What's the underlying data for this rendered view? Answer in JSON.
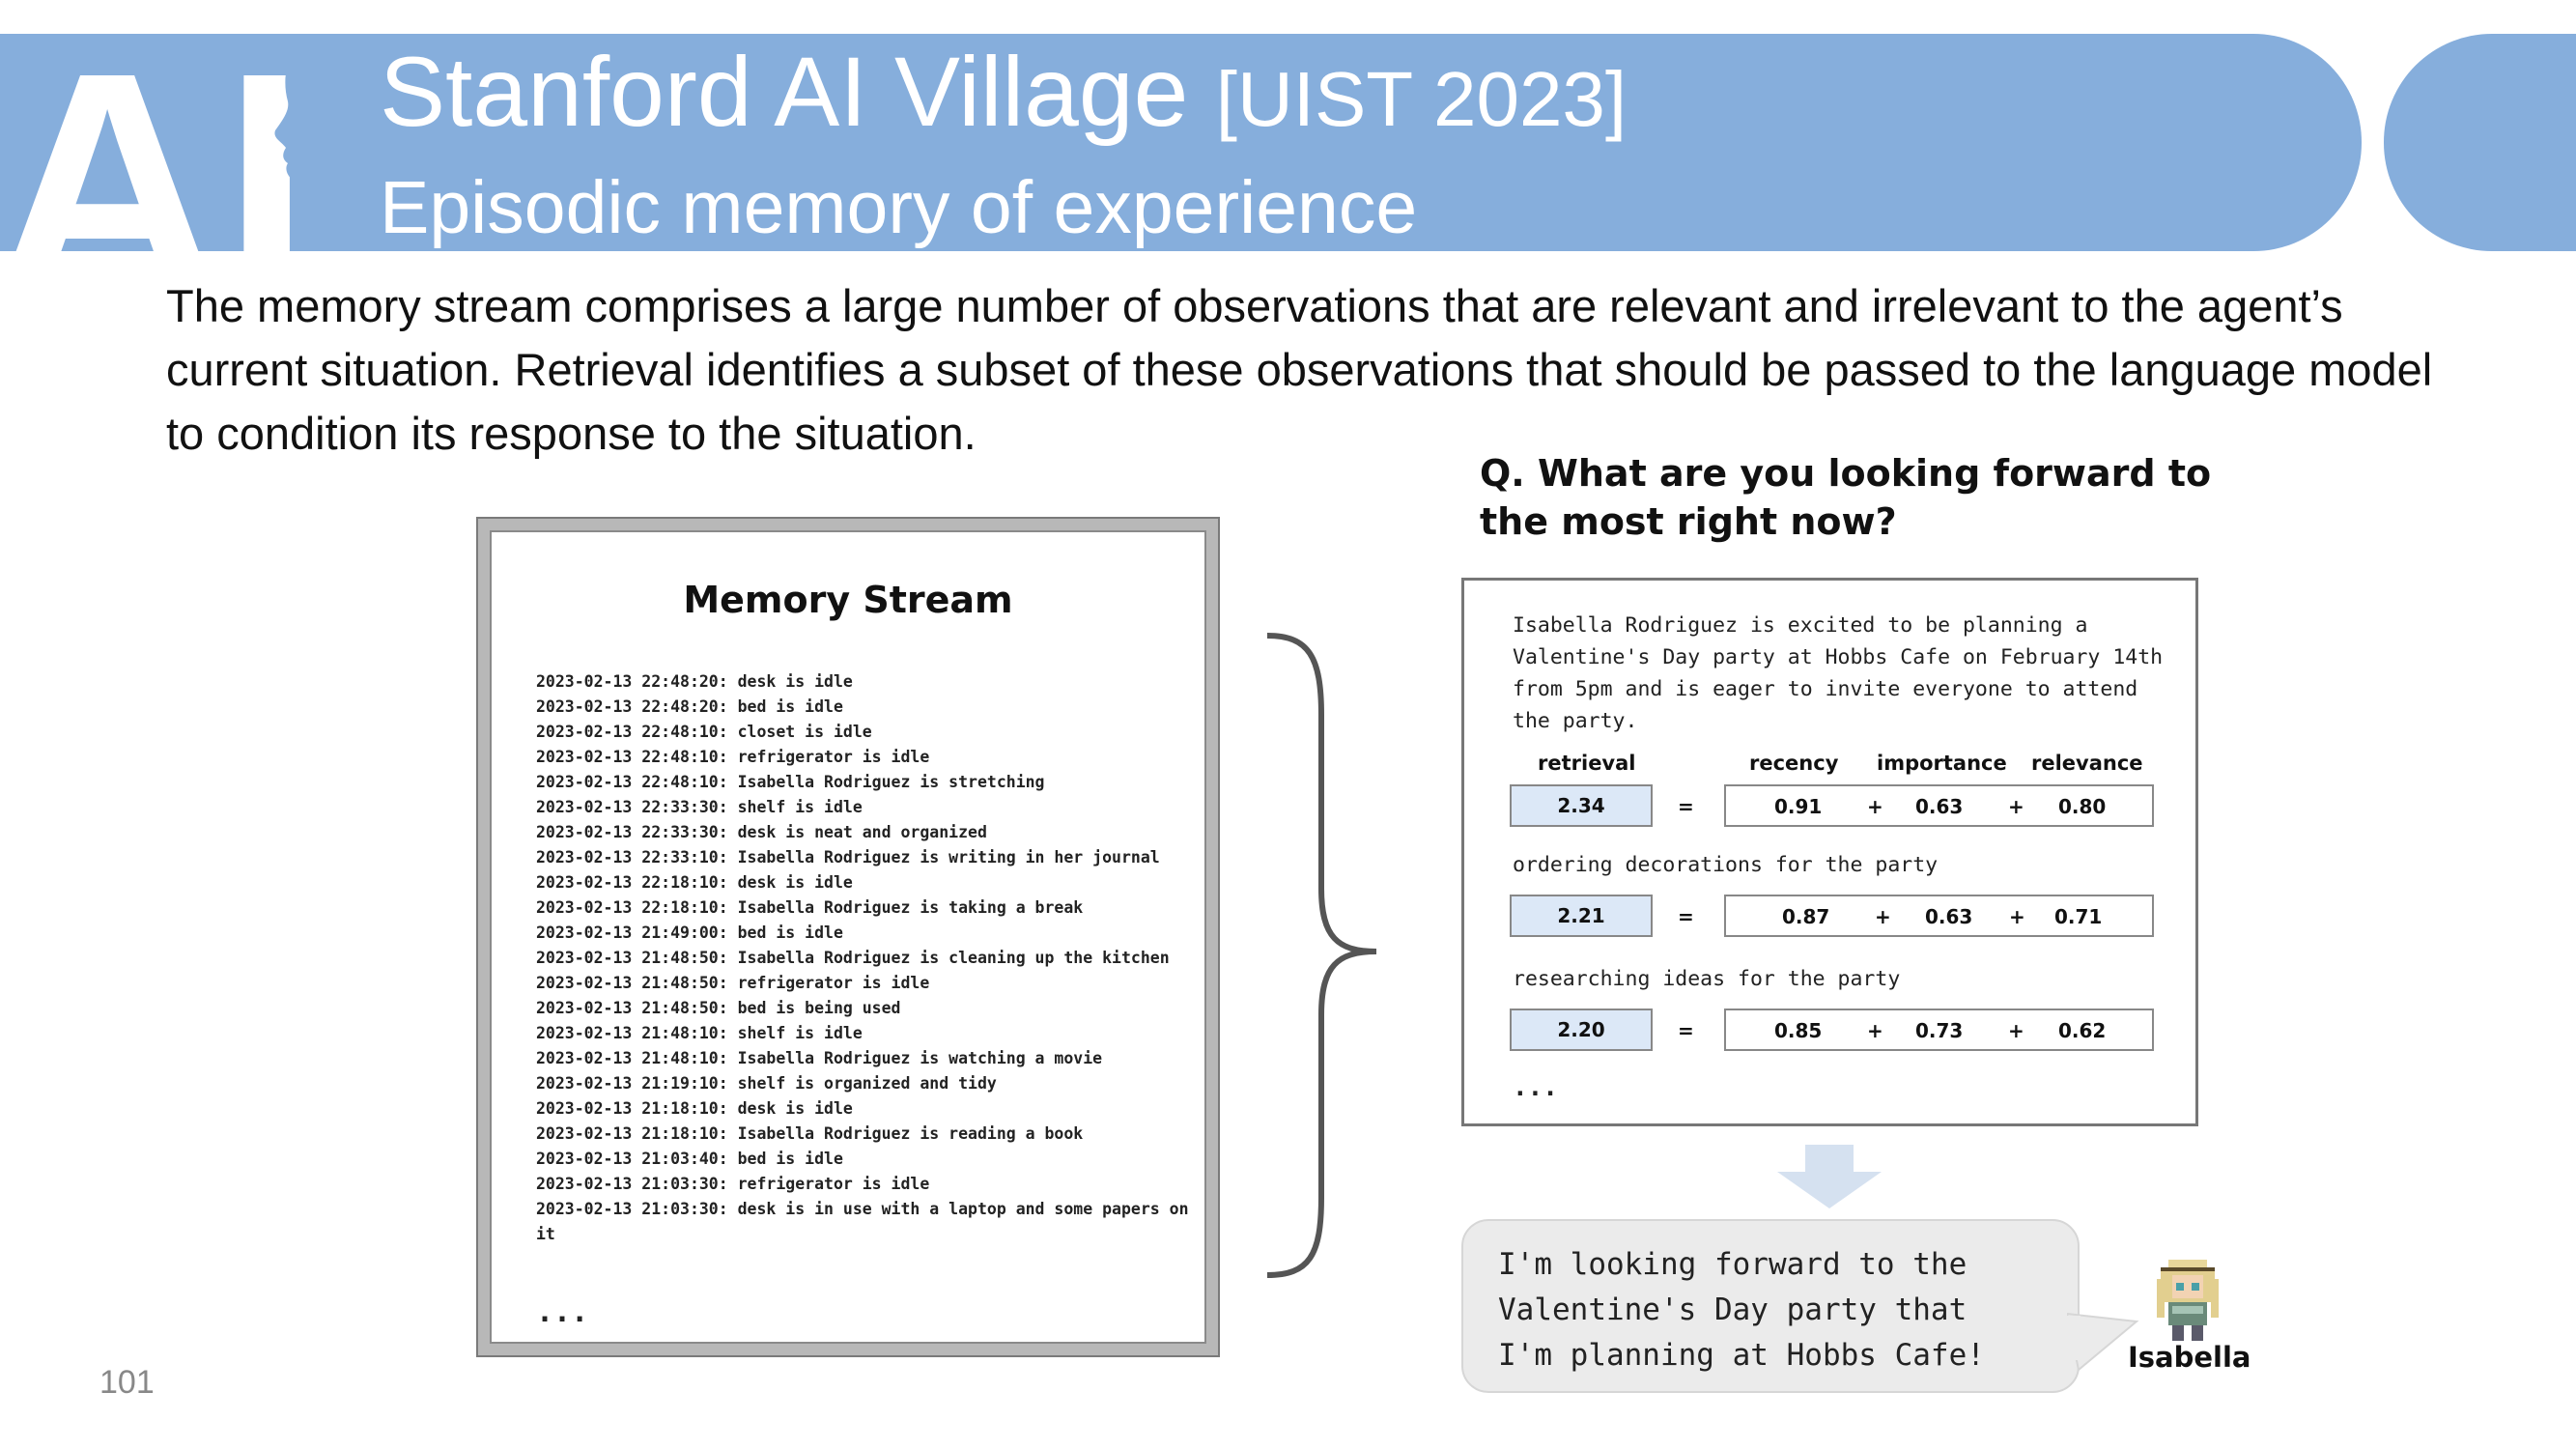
{
  "header": {
    "logo_letters": "AI",
    "title": "Stanford AI Village",
    "title_tag": "[UIST 2023]",
    "subtitle": "Episodic memory of experience"
  },
  "body_text": "The memory stream comprises a large number of observations that are relevant and irrelevant to the agent’s current situation. Retrieval identifies a subset of these observations that should be passed to the language model to condition its response to the situation.",
  "memory_stream": {
    "title": "Memory Stream",
    "entries": [
      "2023-02-13 22:48:20: desk is idle",
      "2023-02-13 22:48:20: bed is idle",
      "2023-02-13 22:48:10: closet is idle",
      "2023-02-13 22:48:10: refrigerator is idle",
      "2023-02-13 22:48:10: Isabella Rodriguez is stretching",
      "2023-02-13 22:33:30: shelf is idle",
      "2023-02-13 22:33:30: desk is neat and organized",
      "2023-02-13 22:33:10: Isabella Rodriguez is writing in her journal",
      "2023-02-13 22:18:10: desk is idle",
      "2023-02-13 22:18:10: Isabella Rodriguez is taking a break",
      "2023-02-13 21:49:00: bed is idle",
      "2023-02-13 21:48:50: Isabella Rodriguez is cleaning up the kitchen",
      "2023-02-13 21:48:50: refrigerator is idle",
      "2023-02-13 21:48:50: bed is being used",
      "2023-02-13 21:48:10: shelf is idle",
      "2023-02-13 21:48:10: Isabella Rodriguez is watching a movie",
      "2023-02-13 21:19:10: shelf is organized and tidy",
      "2023-02-13 21:18:10: desk is idle",
      "2023-02-13 21:18:10: Isabella Rodriguez is reading a book",
      "2023-02-13 21:03:40: bed is idle",
      "2023-02-13 21:03:30: refrigerator is idle",
      "2023-02-13 21:03:30: desk is in use with a laptop and some papers on it"
    ],
    "ellipsis": "..."
  },
  "question": "Q. What are you looking forward to the most right now?",
  "retrieval": {
    "headers": {
      "retrieval": "retrieval",
      "recency": "recency",
      "importance": "importance",
      "relevance": "relevance"
    },
    "memories": [
      {
        "text": "Isabella Rodriguez is excited to be planning a Valentine's Day party at Hobbs Cafe on February 14th from 5pm and is eager to invite everyone to attend the party.",
        "retrieval": "2.34",
        "recency": "0.91",
        "importance": "0.63",
        "relevance": "0.80"
      },
      {
        "text": "ordering decorations for the party",
        "retrieval": "2.21",
        "recency": "0.87",
        "importance": "0.63",
        "relevance": "0.71"
      },
      {
        "text": "researching ideas for the party",
        "retrieval": "2.20",
        "recency": "0.85",
        "importance": "0.73",
        "relevance": "0.62"
      }
    ],
    "equals": "=",
    "plus": "+",
    "ellipsis": "..."
  },
  "answer": {
    "lines": [
      "I'm looking forward to the",
      "Valentine's Day party that",
      "I'm planning at Hobbs Cafe!"
    ],
    "speaker": "Isabella"
  },
  "page_number": "101",
  "colors": {
    "band": "#86aedc",
    "retrieval_fill": "#dce8f7",
    "bubble": "#ebebeb"
  }
}
